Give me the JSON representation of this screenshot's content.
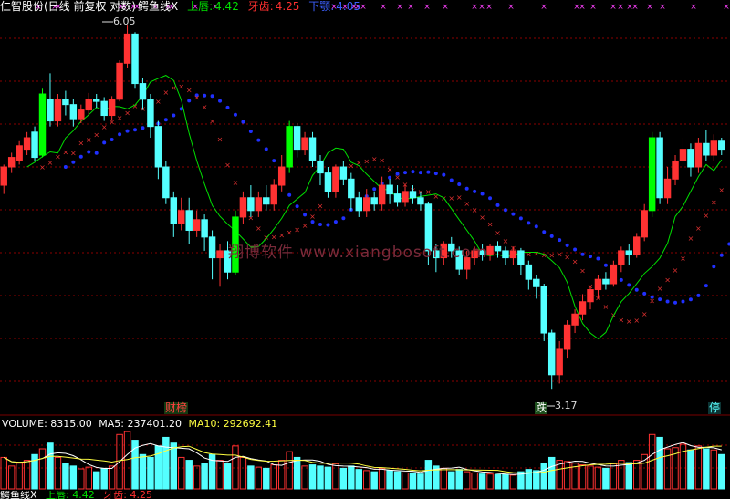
{
  "header": {
    "title": "仁智股份(日线 前复权 对数)",
    "indicator_name": "鳄鱼线X",
    "upper_lip_label": "上唇:",
    "upper_lip_value": "4.42",
    "teeth_label": "牙齿:",
    "teeth_value": "4.25",
    "jaw_label": "下颚:",
    "jaw_value": "4.05"
  },
  "colors": {
    "background": "#000000",
    "up_candle": "#ff3232",
    "down_candle": "#54ffff",
    "limit_up": "#00ff00",
    "grid": "#8b0000",
    "jaw_dots": "#2030ff",
    "teeth_x": "#e03030",
    "lip_line": "#00e000",
    "markers": "#ff40ff"
  },
  "annotations": {
    "high_label": "6.05",
    "low_label": "3.17",
    "tag_finance": "财榜",
    "tag_drop": "跌",
    "tag_stop": "停",
    "watermark": "翔博软件 www.xiangbosoft.com"
  },
  "volume_header": {
    "volume_label": "VOLUME: 8315.00",
    "ma5_label": "MA5: 237401.20",
    "ma10_label": "MA10: 292692.41"
  },
  "bottom_header": {
    "name": "鳄鱼线X",
    "upper_lip": "上唇: 4.42",
    "teeth": "牙齿: 4.25"
  },
  "chart_data": {
    "type": "candlestick",
    "price_high": 6.05,
    "price_low": 3.17,
    "last_values": {
      "upper_lip": 4.42,
      "teeth": 4.25,
      "jaw": 4.05
    },
    "candles": [
      [
        4.55,
        4.7,
        4.48,
        4.72,
        0.55
      ],
      [
        4.7,
        4.78,
        4.65,
        4.82,
        0.4
      ],
      [
        4.75,
        4.88,
        4.72,
        4.92,
        0.45
      ],
      [
        4.85,
        4.95,
        4.8,
        5.0,
        0.5
      ],
      [
        5.0,
        4.78,
        4.75,
        5.05,
        0.6
      ],
      [
        4.8,
        5.35,
        4.78,
        5.4,
        0.7
      ],
      [
        5.3,
        5.1,
        5.05,
        5.55,
        0.8
      ],
      [
        5.1,
        5.3,
        5.05,
        5.35,
        0.55
      ],
      [
        5.3,
        5.25,
        5.15,
        5.38,
        0.45
      ],
      [
        5.25,
        5.12,
        5.05,
        5.3,
        0.4
      ],
      [
        5.12,
        5.2,
        5.08,
        5.25,
        0.35
      ],
      [
        5.2,
        5.3,
        5.15,
        5.36,
        0.38
      ],
      [
        5.3,
        5.28,
        5.22,
        5.35,
        0.3
      ],
      [
        5.28,
        5.15,
        5.1,
        5.32,
        0.36
      ],
      [
        5.15,
        5.3,
        5.1,
        5.33,
        0.4
      ],
      [
        5.3,
        5.65,
        5.28,
        5.68,
        0.95
      ],
      [
        5.65,
        5.95,
        5.6,
        6.05,
        1.0
      ],
      [
        5.95,
        5.45,
        5.4,
        5.97,
        0.85
      ],
      [
        5.45,
        5.3,
        5.2,
        5.5,
        0.6
      ],
      [
        5.3,
        5.05,
        4.95,
        5.35,
        0.55
      ],
      [
        5.05,
        4.7,
        4.6,
        5.1,
        0.75
      ],
      [
        4.7,
        4.45,
        4.4,
        4.75,
        0.9
      ],
      [
        4.45,
        4.25,
        4.15,
        4.5,
        0.8
      ],
      [
        4.25,
        4.35,
        4.2,
        4.45,
        0.55
      ],
      [
        4.35,
        4.2,
        4.1,
        4.45,
        0.5
      ],
      [
        4.2,
        4.28,
        4.15,
        4.35,
        0.4
      ],
      [
        4.28,
        4.15,
        4.05,
        4.32,
        0.45
      ],
      [
        4.15,
        4.0,
        3.85,
        4.2,
        0.6
      ],
      [
        4.0,
        4.05,
        3.8,
        4.1,
        0.5
      ],
      [
        4.05,
        3.9,
        3.85,
        4.12,
        0.45
      ],
      [
        3.9,
        4.3,
        3.88,
        4.35,
        0.75
      ],
      [
        4.3,
        4.45,
        4.25,
        4.5,
        0.55
      ],
      [
        4.45,
        4.35,
        4.3,
        4.55,
        0.4
      ],
      [
        4.35,
        4.45,
        4.3,
        4.5,
        0.38
      ],
      [
        4.45,
        4.4,
        4.35,
        4.55,
        0.36
      ],
      [
        4.4,
        4.55,
        4.35,
        4.6,
        0.42
      ],
      [
        4.55,
        4.7,
        4.5,
        4.8,
        0.5
      ],
      [
        4.7,
        5.05,
        4.65,
        5.1,
        0.65
      ],
      [
        5.05,
        4.85,
        4.78,
        5.08,
        0.55
      ],
      [
        4.85,
        4.95,
        4.8,
        5.0,
        0.4
      ],
      [
        4.95,
        4.75,
        4.7,
        5.0,
        0.42
      ],
      [
        4.75,
        4.65,
        4.55,
        4.8,
        0.4
      ],
      [
        4.65,
        4.5,
        4.45,
        4.7,
        0.38
      ],
      [
        4.5,
        4.7,
        4.45,
        4.72,
        0.44
      ],
      [
        4.7,
        4.6,
        4.55,
        4.75,
        0.36
      ],
      [
        4.6,
        4.45,
        4.35,
        4.65,
        0.4
      ],
      [
        4.45,
        4.35,
        4.3,
        4.5,
        0.34
      ],
      [
        4.35,
        4.45,
        4.3,
        4.52,
        0.32
      ],
      [
        4.45,
        4.4,
        4.35,
        4.5,
        0.3
      ],
      [
        4.4,
        4.55,
        4.35,
        4.62,
        0.36
      ],
      [
        4.55,
        4.48,
        4.4,
        4.6,
        0.32
      ],
      [
        4.48,
        4.42,
        4.38,
        4.55,
        0.3
      ],
      [
        4.42,
        4.5,
        4.38,
        4.55,
        0.28
      ],
      [
        4.5,
        4.45,
        4.4,
        4.55,
        0.28
      ],
      [
        4.45,
        4.4,
        4.35,
        4.5,
        0.26
      ],
      [
        4.4,
        4.05,
        3.95,
        4.42,
        0.5
      ],
      [
        4.05,
        4.0,
        3.9,
        4.1,
        0.4
      ],
      [
        4.0,
        4.1,
        3.95,
        4.12,
        0.36
      ],
      [
        4.1,
        4.05,
        4.0,
        4.15,
        0.3
      ],
      [
        4.05,
        3.92,
        3.88,
        4.08,
        0.34
      ],
      [
        3.92,
        4.0,
        3.85,
        4.05,
        0.3
      ],
      [
        4.0,
        4.05,
        3.95,
        4.08,
        0.28
      ],
      [
        4.05,
        4.02,
        3.98,
        4.1,
        0.26
      ],
      [
        4.02,
        4.08,
        3.98,
        4.1,
        0.26
      ],
      [
        4.08,
        4.05,
        4.0,
        4.12,
        0.25
      ],
      [
        4.05,
        4.0,
        3.95,
        4.08,
        0.25
      ],
      [
        4.0,
        4.05,
        3.95,
        4.08,
        0.24
      ],
      [
        4.05,
        3.95,
        3.88,
        4.07,
        0.3
      ],
      [
        3.95,
        3.85,
        3.78,
        3.98,
        0.34
      ],
      [
        3.85,
        3.8,
        3.72,
        3.88,
        0.32
      ],
      [
        3.8,
        3.5,
        3.45,
        3.82,
        0.45
      ],
      [
        3.5,
        3.25,
        3.17,
        3.52,
        0.55
      ],
      [
        3.25,
        3.4,
        3.2,
        3.45,
        0.5
      ],
      [
        3.4,
        3.55,
        3.35,
        3.58,
        0.48
      ],
      [
        3.55,
        3.62,
        3.5,
        3.65,
        0.45
      ],
      [
        3.62,
        3.7,
        3.58,
        3.75,
        0.42
      ],
      [
        3.7,
        3.78,
        3.65,
        3.8,
        0.4
      ],
      [
        3.78,
        3.85,
        3.72,
        3.88,
        0.38
      ],
      [
        3.85,
        3.82,
        3.78,
        3.9,
        0.36
      ],
      [
        3.82,
        3.95,
        3.8,
        3.98,
        0.44
      ],
      [
        3.95,
        4.05,
        3.9,
        4.08,
        0.5
      ],
      [
        4.05,
        4.02,
        3.95,
        4.1,
        0.46
      ],
      [
        4.02,
        4.15,
        4.0,
        4.18,
        0.5
      ],
      [
        4.15,
        4.35,
        4.12,
        4.4,
        0.6
      ],
      [
        4.35,
        4.95,
        4.3,
        5.0,
        0.95
      ],
      [
        4.95,
        4.45,
        4.4,
        5.0,
        0.9
      ],
      [
        4.45,
        4.6,
        4.4,
        4.7,
        0.7
      ],
      [
        4.6,
        4.75,
        4.55,
        4.8,
        0.72
      ],
      [
        4.75,
        4.85,
        4.7,
        4.95,
        0.78
      ],
      [
        4.85,
        4.7,
        4.62,
        4.9,
        0.68
      ],
      [
        4.7,
        4.9,
        4.65,
        4.95,
        0.75
      ],
      [
        4.9,
        4.8,
        4.75,
        5.02,
        0.7
      ],
      [
        4.8,
        4.92,
        4.75,
        4.98,
        0.68
      ],
      [
        4.92,
        4.85,
        4.8,
        4.95,
        0.6
      ]
    ]
  }
}
